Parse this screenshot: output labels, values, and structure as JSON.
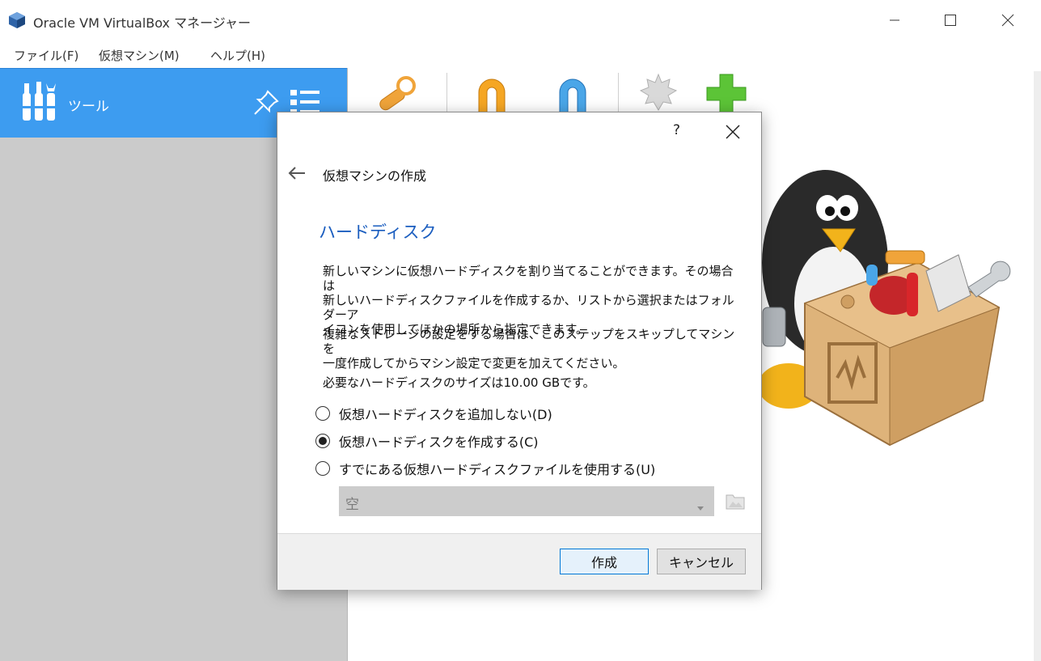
{
  "window": {
    "title": "Oracle VM VirtualBox マネージャー"
  },
  "menu": [
    {
      "label": "ファイル(F)"
    },
    {
      "label": "仮想マシン(M)"
    },
    {
      "label": "ヘルプ(H)"
    }
  ],
  "sidebar": {
    "tools_label": "ツール"
  },
  "toolbar": {
    "icons": [
      "preferences-icon",
      "import-icon",
      "export-icon",
      "extension-icon",
      "new-icon"
    ]
  },
  "dialog": {
    "help": "?",
    "wizard_title": "仮想マシンの作成",
    "page_title": "ハードディスク",
    "para1_lines": [
      "新しいマシンに仮想ハードディスクを割り当てることができます。その場合は",
      "新しいハードディスクファイルを作成するか、リストから選択またはフォルダーア",
      "イコンを使用してほかの場所から指定できます。"
    ],
    "para2_lines": [
      "複雑なストレージの設定をする場合は、このステップをスキップしてマシンを",
      "一度作成してからマシン設定で変更を加えてください。"
    ],
    "size_line": "必要なハードディスクのサイズは10.00 GBです。",
    "options": [
      {
        "label": "仮想ハードディスクを追加しない(D)",
        "selected": false
      },
      {
        "label": "仮想ハードディスクを作成する(C)",
        "selected": true
      },
      {
        "label": "すでにある仮想ハードディスクファイルを使用する(U)",
        "selected": false
      }
    ],
    "combo_value": "空",
    "create_button": "作成",
    "cancel_button": "キャンセル"
  },
  "colors": {
    "tools_bg": "#3d9cf0",
    "left_panel": "#cbcbcb",
    "page_title": "#1a5dbf",
    "primary_border": "#0078d7"
  }
}
